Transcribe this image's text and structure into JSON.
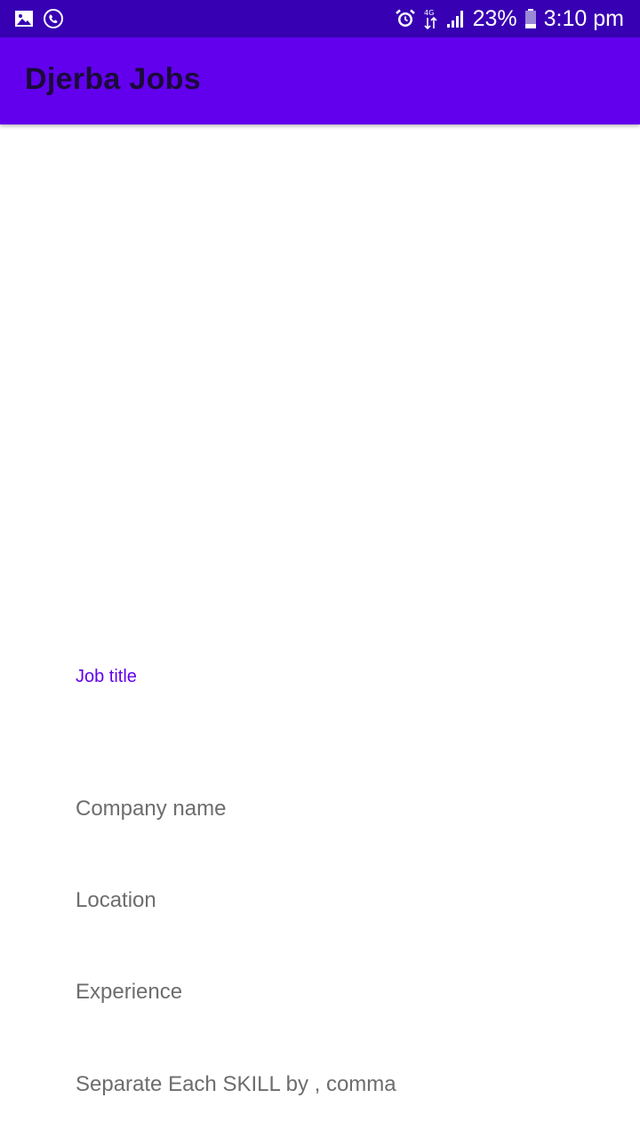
{
  "status_bar": {
    "battery": "23%",
    "time": "3:10 pm",
    "network": "4G"
  },
  "app_bar": {
    "title": "Djerba Jobs"
  },
  "form": {
    "job_title_label": "Job title",
    "company_name_label": "Company name",
    "location_label": "Location",
    "experience_label": "Experience",
    "skills_label": "Separate Each SKILL by , comma"
  },
  "colors": {
    "status_bar": "#3700b3",
    "app_bar": "#6200ee",
    "accent": "#6200ee",
    "label": "#6d6d6d"
  },
  "icons": [
    "image-icon",
    "whatsapp-call-icon",
    "alarm-icon",
    "data-arrows-icon",
    "signal-icon",
    "battery-icon"
  ]
}
